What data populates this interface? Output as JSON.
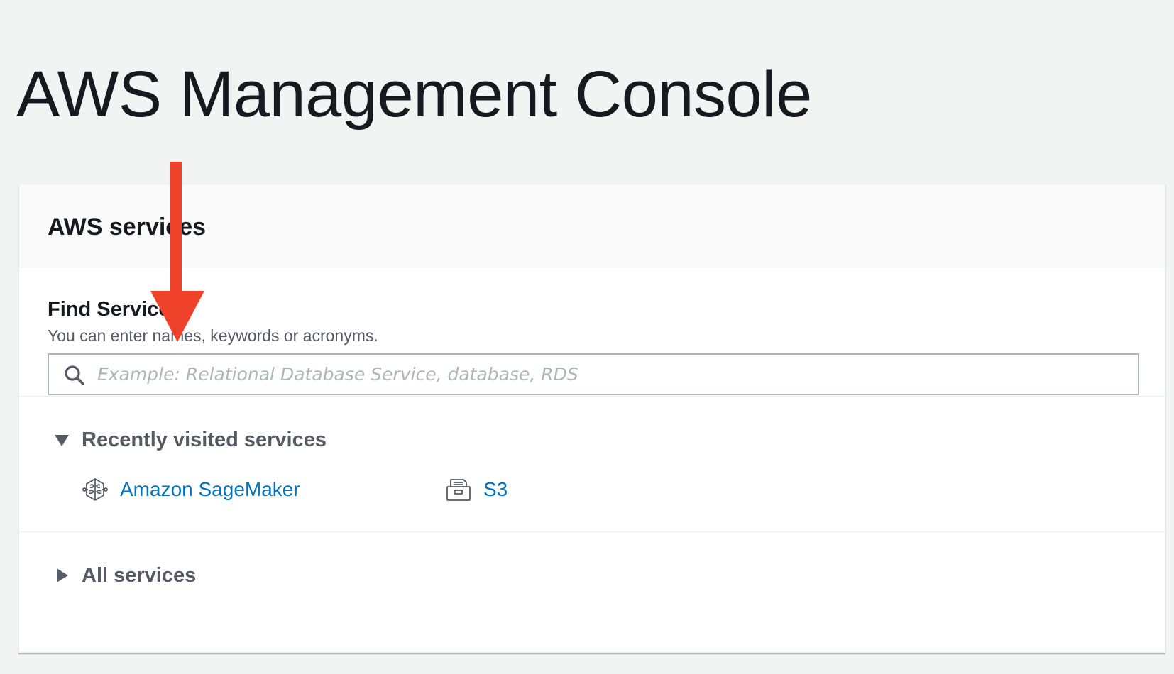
{
  "page": {
    "title": "AWS Management Console"
  },
  "panel": {
    "title": "AWS services",
    "find": {
      "label": "Find Services",
      "description": "You can enter names, keywords or acronyms.",
      "placeholder": "Example: Relational Database Service, database, RDS",
      "value": "",
      "icon": "search-icon"
    },
    "recent": {
      "label": "Recently visited services",
      "expanded": true,
      "services": [
        {
          "label": "Amazon SageMaker",
          "icon": "sagemaker-brain-icon"
        },
        {
          "label": "S3",
          "icon": "s3-bucket-icon"
        }
      ]
    },
    "all": {
      "label": "All services",
      "expanded": false
    }
  },
  "colors": {
    "background": "#f2f3f3",
    "link": "#0073bb",
    "annotation_arrow": "#f0412a",
    "text_dark": "#16191f",
    "text_secondary": "#545b64"
  }
}
